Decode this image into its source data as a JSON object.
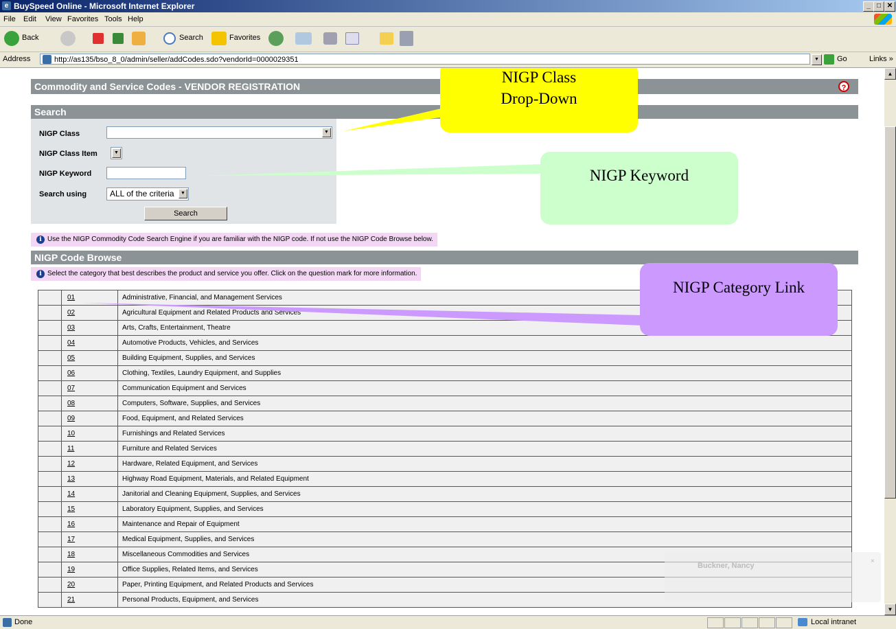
{
  "window": {
    "title": "BuySpeed Online - Microsoft Internet Explorer",
    "buttons": [
      "_",
      "□",
      "✕"
    ]
  },
  "menu": [
    "File",
    "Edit",
    "View",
    "Favorites",
    "Tools",
    "Help"
  ],
  "toolbar": {
    "back": "Back",
    "search": "Search",
    "favorites": "Favorites"
  },
  "address": {
    "label": "Address",
    "url": "http://as135/bso_8_0/admin/seller/addCodes.sdo?vendorId=0000029351",
    "go": "Go",
    "links": "Links »"
  },
  "page": {
    "title": "Commodity and Service Codes - VENDOR REGISTRATION",
    "help": "?",
    "search_header": "Search",
    "fields": {
      "nigp_class": "NIGP Class",
      "nigp_class_item": "NIGP Class Item",
      "nigp_keyword": "NIGP Keyword",
      "search_using": "Search using",
      "search_using_value": "ALL of the criteria"
    },
    "search_button": "Search",
    "search_info": "Use the NIGP Commodity Code Search Engine if you are familiar with the NIGP code. If not use the NIGP Code Browse below.",
    "browse_header": "NIGP Code Browse",
    "browse_info": "Select the category that best describes the product and service you offer. Click on the question mark for more information.",
    "codes": [
      {
        "code": "01",
        "desc": "Administrative, Financial, and Management Services"
      },
      {
        "code": "02",
        "desc": "Agricultural Equipment and Related Products and Services"
      },
      {
        "code": "03",
        "desc": "Arts, Crafts, Entertainment, Theatre"
      },
      {
        "code": "04",
        "desc": "Automotive Products, Vehicles, and Services"
      },
      {
        "code": "05",
        "desc": "Building Equipment, Supplies, and Services"
      },
      {
        "code": "06",
        "desc": "Clothing, Textiles, Laundry Equipment, and Supplies"
      },
      {
        "code": "07",
        "desc": "Communication Equipment and Services"
      },
      {
        "code": "08",
        "desc": "Computers, Software, Supplies, and Services"
      },
      {
        "code": "09",
        "desc": "Food, Equipment, and Related Services"
      },
      {
        "code": "10",
        "desc": "Furnishings and Related Services"
      },
      {
        "code": "11",
        "desc": "Furniture and Related Services"
      },
      {
        "code": "12",
        "desc": "Hardware, Related Equipment, and Services"
      },
      {
        "code": "13",
        "desc": "Highway Road Equipment, Materials, and Related Equipment"
      },
      {
        "code": "14",
        "desc": "Janitorial and Cleaning Equipment, Supplies, and Services"
      },
      {
        "code": "15",
        "desc": "Laboratory Equipment, Supplies, and Services"
      },
      {
        "code": "16",
        "desc": "Maintenance and Repair of Equipment"
      },
      {
        "code": "17",
        "desc": "Medical Equipment, Supplies, and Services"
      },
      {
        "code": "18",
        "desc": "Miscellaneous Commodities and Services"
      },
      {
        "code": "19",
        "desc": "Office Supplies, Related Items, and Services"
      },
      {
        "code": "20",
        "desc": "Paper, Printing Equipment, and Related Products and Services"
      },
      {
        "code": "21",
        "desc": "Personal Products, Equipment, and Services"
      }
    ]
  },
  "callouts": {
    "class_dropdown": "NIGP Class Drop-Down",
    "keyword": "NIGP Keyword",
    "category_link": "NIGP Category Link"
  },
  "notification": {
    "name": "Buckner, Nancy"
  },
  "status": {
    "left": "Done",
    "zone": "Local intranet"
  },
  "colors": {
    "header_bar": "#8c9396",
    "info_bg": "#f3d6f3",
    "callout_yellow": "#ffff00",
    "callout_green": "#ccffcc",
    "callout_purple": "#cc99ff"
  }
}
